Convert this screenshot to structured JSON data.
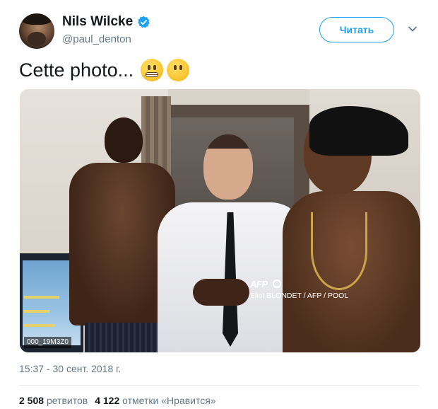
{
  "author": {
    "display_name": "Nils Wilcke",
    "handle": "@paul_denton",
    "verified_icon": "verified-badge-icon",
    "avatar_icon": "avatar"
  },
  "actions": {
    "follow_label": "Читать",
    "more_icon": "chevron-down-icon"
  },
  "tweet": {
    "text": "Cette photo...",
    "emojis": [
      "grimacing-face-emoji",
      "face-without-mouth-emoji"
    ]
  },
  "photo": {
    "credit_logo": "AFP",
    "credit_text": "Eliot BLONDET / AFP / POOL",
    "photo_id": "000_19M3Z0"
  },
  "meta": {
    "timestamp": "15:37 - 30 сент. 2018 г."
  },
  "stats": {
    "retweets_count": "2 508",
    "retweets_label": "ретвитов",
    "likes_count": "4 122",
    "likes_label": "отметки «Нравится»"
  },
  "colors": {
    "accent": "#1da1f2",
    "text_primary": "#14171a",
    "text_secondary": "#657786",
    "divider": "#e6ecf0"
  }
}
